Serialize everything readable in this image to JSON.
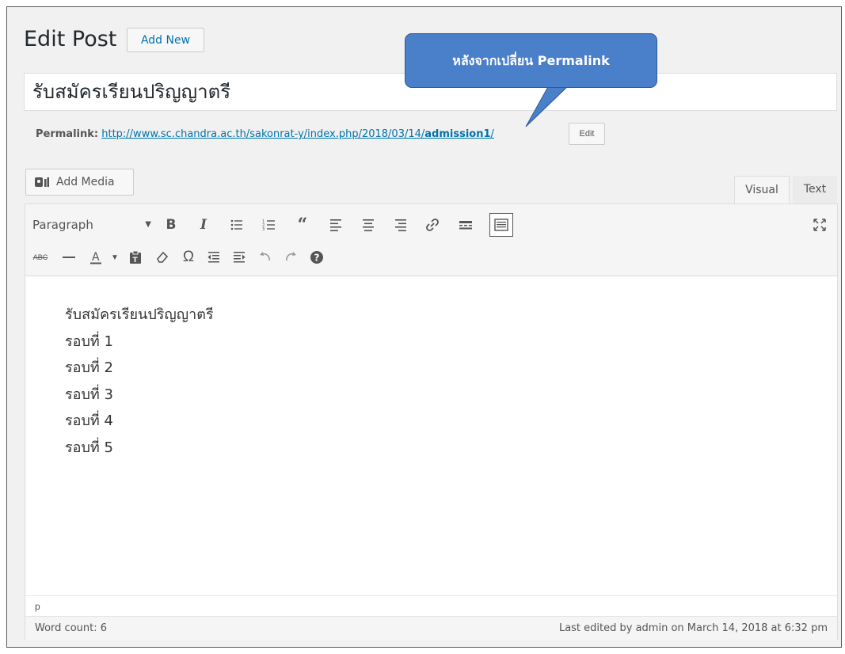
{
  "page": {
    "heading": "Edit Post",
    "add_new_label": "Add New"
  },
  "post": {
    "title": "รับสมัครเรียนปริญญาตรี"
  },
  "permalink": {
    "label": "Permalink:",
    "url_prefix": "http://www.sc.chandra.ac.th/sakonrat-y/index.php/2018/03/14/",
    "slug": "admission1",
    "url_suffix": "/",
    "edit_label": "Edit"
  },
  "callout": {
    "text": "หลังจากเปลี่ยน Permalink",
    "color": "#4a7fc9"
  },
  "media": {
    "add_media_label": "Add Media"
  },
  "editor_tabs": [
    {
      "label": "Visual",
      "active": true
    },
    {
      "label": "Text",
      "active": false
    }
  ],
  "toolbar": {
    "format_select": "Paragraph",
    "row1_icons": [
      "bold-icon",
      "italic-icon",
      "bullet-list-icon",
      "numbered-list-icon",
      "blockquote-icon",
      "align-left-icon",
      "align-center-icon",
      "align-right-icon",
      "link-icon",
      "read-more-icon",
      "toolbar-toggle-icon",
      "fullscreen-icon"
    ],
    "row2_icons": [
      "strikethrough-icon",
      "horizontal-line-icon",
      "text-color-icon",
      "paste-as-text-icon",
      "clear-formatting-icon",
      "special-character-icon",
      "outdent-icon",
      "indent-icon",
      "undo-icon",
      "redo-icon",
      "help-icon"
    ]
  },
  "content": {
    "lines": [
      "รับสมัครเรียนปริญญาตรี",
      "รอบที่ 1",
      "รอบที่ 2",
      "รอบที่ 3",
      "รอบที่ 4",
      "รอบที่ 5"
    ]
  },
  "status": {
    "path": "p",
    "word_count": "Word count: 6",
    "last_edited": "Last edited by admin on March 14, 2018 at 6:32 pm"
  }
}
